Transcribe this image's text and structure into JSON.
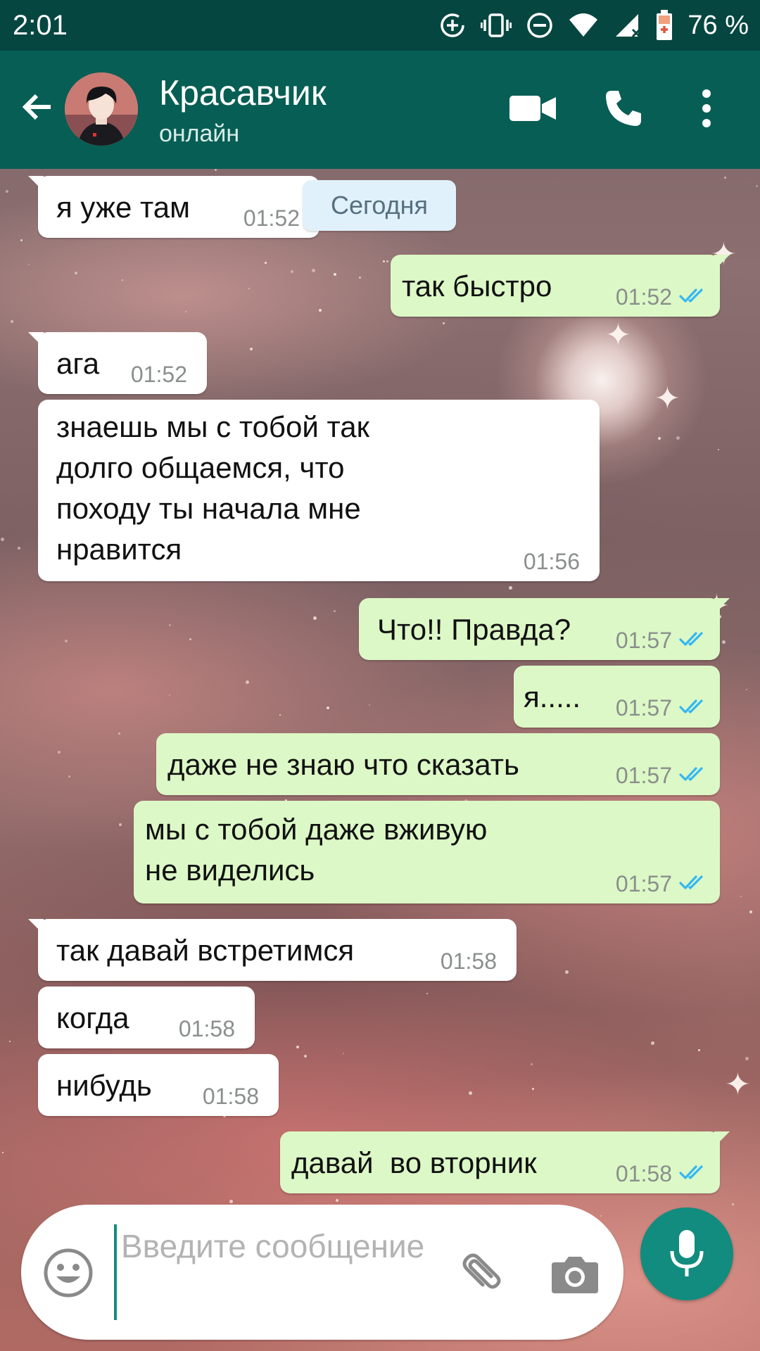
{
  "status_bar": {
    "time": "2:01",
    "battery_text": "76 %",
    "icons": [
      "data-saver-icon",
      "vibrate-icon",
      "do-not-disturb-icon",
      "wifi-icon",
      "signal-icon",
      "battery-charging-icon"
    ]
  },
  "header": {
    "contact_name": "Красавчик",
    "contact_status": "онлайн",
    "icons": [
      "back-arrow-icon",
      "avatar",
      "video-call-icon",
      "phone-icon",
      "more-vert-icon"
    ]
  },
  "date_chip": "Сегодня",
  "messages": [
    {
      "dir": "in",
      "text": "я уже там",
      "time": "01:52"
    },
    {
      "dir": "out",
      "text": "так быстро",
      "time": "01:52",
      "read": true
    },
    {
      "dir": "in",
      "text": "ага",
      "time": "01:52"
    },
    {
      "dir": "in",
      "text": "знаешь мы с тобой так\nдолго общаемся, что\nпоходу ты начала мне\nнравится",
      "time": "01:56"
    },
    {
      "dir": "out",
      "text": "Что!! Правда?",
      "time": "01:57",
      "read": true
    },
    {
      "dir": "out",
      "text": "я.....",
      "time": "01:57",
      "read": true
    },
    {
      "dir": "out",
      "text": "даже не знаю что сказать",
      "time": "01:57",
      "read": true
    },
    {
      "dir": "out",
      "text": "мы с тобой даже вживую\nне виделись",
      "time": "01:57",
      "read": true
    },
    {
      "dir": "in",
      "text": "так давай встретимся",
      "time": "01:58"
    },
    {
      "dir": "in",
      "text": "когда",
      "time": "01:58"
    },
    {
      "dir": "in",
      "text": "нибудь",
      "time": "01:58"
    },
    {
      "dir": "out",
      "text": "давай  во вторник",
      "time": "01:58",
      "read": true
    }
  ],
  "composer": {
    "placeholder": "Введите сообщение",
    "value": "",
    "icons": [
      "emoji-icon",
      "attach-icon",
      "camera-icon",
      "mic-icon"
    ]
  },
  "colors": {
    "status_bar": "#054640",
    "header": "#075e54",
    "outgoing_bubble": "#dcf8c6",
    "incoming_bubble": "#ffffff",
    "read_ticks": "#34b7f1",
    "accent": "#128c7e"
  }
}
